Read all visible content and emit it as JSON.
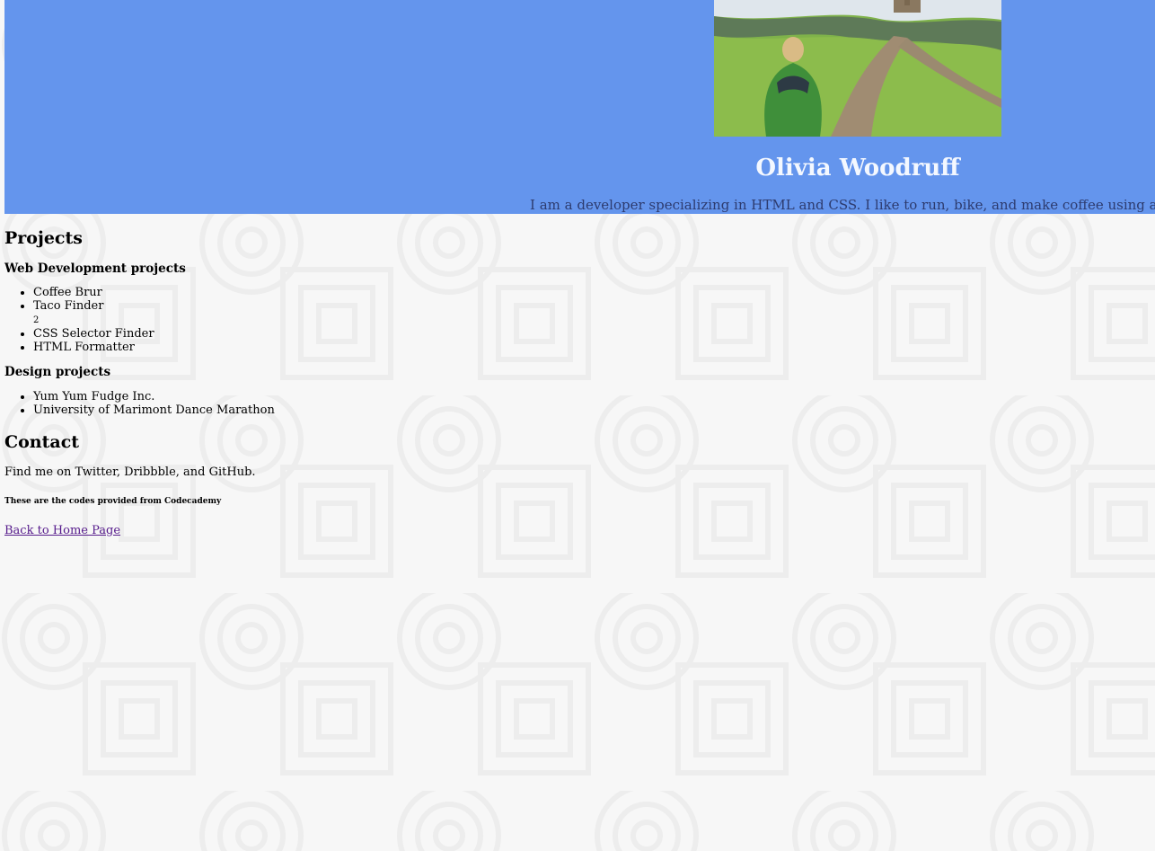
{
  "header": {
    "name": "Olivia Woodruff",
    "bio": "I am a developer specializing in HTML and CSS. I like to run, bike, and make coffee using an Aerop",
    "banner_color": "#6495ed"
  },
  "projects": {
    "title": "Projects",
    "web": {
      "title": "Web Development projects",
      "items": [
        "Coffee Brur",
        "Taco Finder",
        "CSS Selector Finder",
        "HTML Formatter"
      ],
      "stray_text": "2"
    },
    "design": {
      "title": "Design projects",
      "items": [
        "Yum Yum Fudge Inc.",
        "University of Marimont Dance Marathon"
      ]
    }
  },
  "contact": {
    "title": "Contact",
    "text": "Find me on Twitter, Dribbble, and GitHub.",
    "note": "These are the codes provided from Codecademy",
    "link_label": "Back to Home Page",
    "link_color": "#551a8b"
  }
}
